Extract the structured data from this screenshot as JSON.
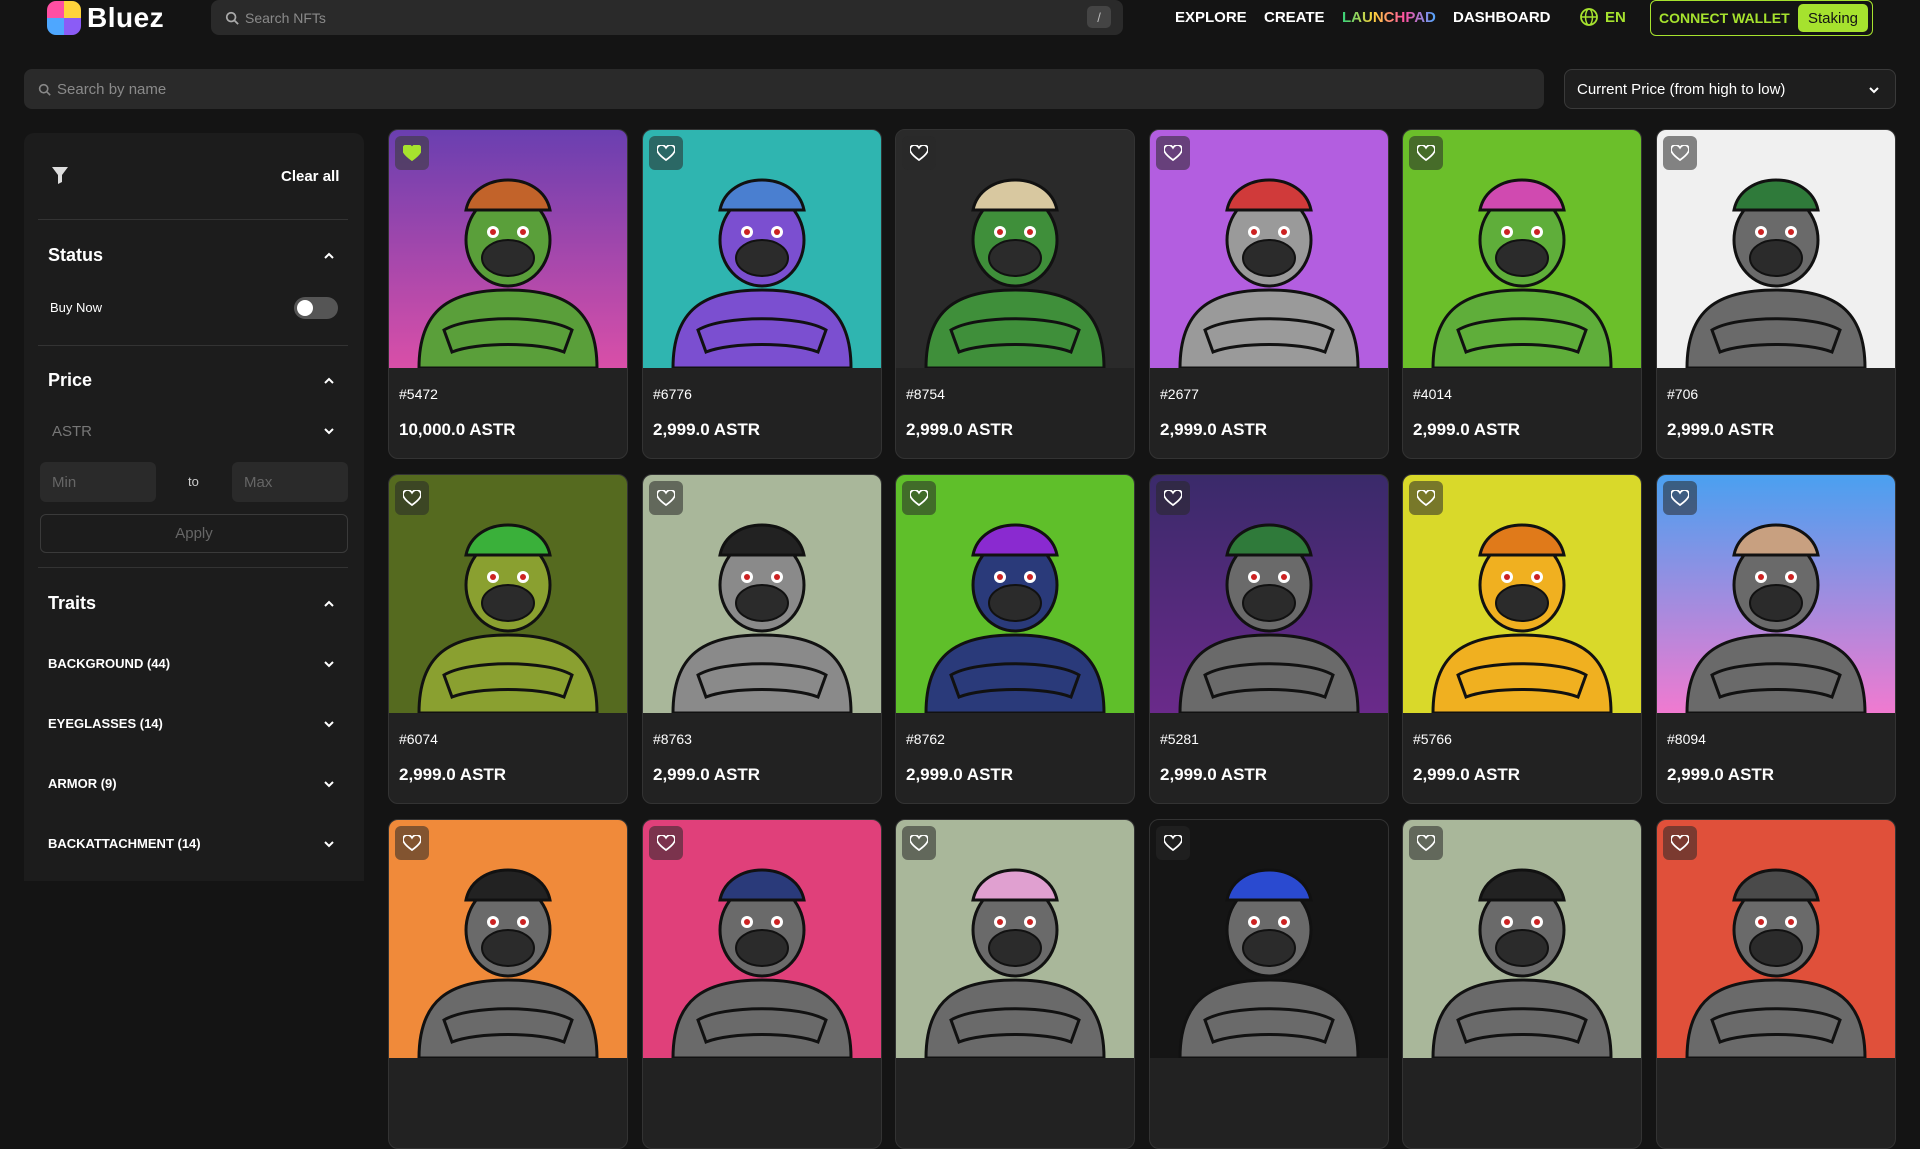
{
  "brand": {
    "name": "Bluez"
  },
  "top_search": {
    "placeholder": "Search NFTs",
    "shortcut": "/"
  },
  "nav": {
    "explore": "EXPLORE",
    "create": "CREATE",
    "launchpad": "LAUNCHPAD",
    "dashboard": "DASHBOARD",
    "language": "EN"
  },
  "wallet": {
    "connect": "CONNECT WALLET",
    "staking": "Staking"
  },
  "name_search": {
    "placeholder": "Search by name"
  },
  "sort": {
    "selected": "Current Price (from high to low)"
  },
  "filters": {
    "clear_all": "Clear all",
    "status": {
      "title": "Status",
      "buy_now": "Buy Now"
    },
    "price": {
      "title": "Price",
      "currency": "ASTR",
      "min_placeholder": "Min",
      "to": "to",
      "max_placeholder": "Max",
      "apply": "Apply"
    },
    "traits": {
      "title": "Traits",
      "items": [
        "BACKGROUND (44)",
        "EYEGLASSES (14)",
        "ARMOR (9)",
        "BACKATTACHMENT (14)"
      ]
    }
  },
  "cards": [
    {
      "id": "#5472",
      "price": "10,000.0 ASTR",
      "favorited": true,
      "bg": "#6a3fb0",
      "bg2": "#d94fa8",
      "skin": "#5a9f3a",
      "top": "#c2632a"
    },
    {
      "id": "#6776",
      "price": "2,999.0 ASTR",
      "favorited": false,
      "bg": "#2fb5b0",
      "bg2": "#2fb5b0",
      "skin": "#7b4fd0",
      "top": "#4a7fd0"
    },
    {
      "id": "#8754",
      "price": "2,999.0 ASTR",
      "favorited": false,
      "bg": "#2a2a2a",
      "bg2": "#2a2a2a",
      "skin": "#3f8f3a",
      "top": "#d8c8a0"
    },
    {
      "id": "#2677",
      "price": "2,999.0 ASTR",
      "favorited": false,
      "bg": "#b35ee0",
      "bg2": "#b35ee0",
      "skin": "#9a9a9a",
      "top": "#d03a3a"
    },
    {
      "id": "#4014",
      "price": "2,999.0 ASTR",
      "favorited": false,
      "bg": "#6bbf2a",
      "bg2": "#6bbf2a",
      "skin": "#5fae3a",
      "top": "#d04ab0"
    },
    {
      "id": "#706",
      "price": "2,999.0 ASTR",
      "favorited": false,
      "bg": "#f0f0f0",
      "bg2": "#f0f0f0",
      "skin": "#6a6a6a",
      "top": "#2f7a3a"
    },
    {
      "id": "#6074",
      "price": "2,999.0 ASTR",
      "favorited": false,
      "bg": "#556a1f",
      "bg2": "#556a1f",
      "skin": "#8aa030",
      "top": "#3ab03a"
    },
    {
      "id": "#8763",
      "price": "2,999.0 ASTR",
      "favorited": false,
      "bg": "#a9b79a",
      "bg2": "#a9b79a",
      "skin": "#8a8a8a",
      "top": "#222222"
    },
    {
      "id": "#8762",
      "price": "2,999.0 ASTR",
      "favorited": false,
      "bg": "#5fbf2a",
      "bg2": "#5fbf2a",
      "skin": "#2a3a7a",
      "top": "#8a2ad0"
    },
    {
      "id": "#5281",
      "price": "2,999.0 ASTR",
      "favorited": false,
      "bg": "#3a2a6a",
      "bg2": "#6a2a8a",
      "skin": "#6a6a6a",
      "top": "#2f7a3a"
    },
    {
      "id": "#5766",
      "price": "2,999.0 ASTR",
      "favorited": false,
      "bg": "#d9d92a",
      "bg2": "#d9d92a",
      "skin": "#f0b020",
      "top": "#e07a1a"
    },
    {
      "id": "#8094",
      "price": "2,999.0 ASTR",
      "favorited": false,
      "bg": "#4aa0f0",
      "bg2": "#f07ad0",
      "skin": "#6a6a6a",
      "top": "#c8a080"
    },
    {
      "id": "",
      "price": "",
      "favorited": false,
      "bg": "#f08a3a",
      "bg2": "#f08a3a",
      "skin": "#6a6a6a",
      "top": "#222222"
    },
    {
      "id": "",
      "price": "",
      "favorited": false,
      "bg": "#e0407a",
      "bg2": "#e0407a",
      "skin": "#6a6a6a",
      "top": "#2a3a7a"
    },
    {
      "id": "",
      "price": "",
      "favorited": false,
      "bg": "#a9b79a",
      "bg2": "#a9b79a",
      "skin": "#6a6a6a",
      "top": "#e0a0d0"
    },
    {
      "id": "",
      "price": "",
      "favorited": false,
      "bg": "#151515",
      "bg2": "#151515",
      "skin": "#6a6a6a",
      "top": "#2a4ad0"
    },
    {
      "id": "",
      "price": "",
      "favorited": false,
      "bg": "#a9b79a",
      "bg2": "#a9b79a",
      "skin": "#6a6a6a",
      "top": "#222222"
    },
    {
      "id": "",
      "price": "",
      "favorited": false,
      "bg": "#e0503a",
      "bg2": "#e0503a",
      "skin": "#6a6a6a",
      "top": "#4a4a4a"
    }
  ],
  "colors": {
    "accent": "#a6e22e",
    "background": "#141414",
    "panel": "#1c1c1c",
    "card": "#222222"
  }
}
